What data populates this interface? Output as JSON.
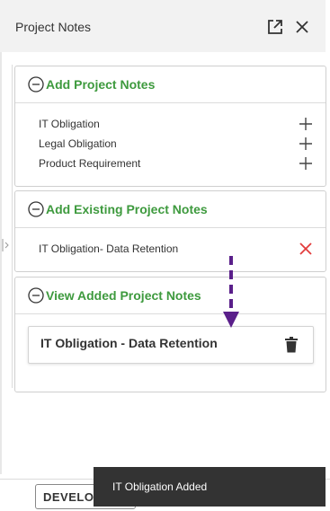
{
  "header": {
    "title": "Project Notes",
    "popout_icon": "external-link-icon",
    "close_icon": "close-icon"
  },
  "add_notes": {
    "title": "Add Project Notes",
    "items": [
      {
        "label": "IT Obligation",
        "action_icon": "plus-icon"
      },
      {
        "label": "Legal Obligation",
        "action_icon": "plus-icon"
      },
      {
        "label": "Product Requirement",
        "action_icon": "plus-icon"
      }
    ]
  },
  "existing_notes": {
    "title": "Add Existing Project Notes",
    "items": [
      {
        "label": "IT Obligation- Data Retention",
        "action_icon": "remove-x-icon"
      }
    ]
  },
  "added_notes": {
    "title": "View Added Project Notes",
    "cards": [
      {
        "title": "IT Obligation - Data Retention",
        "action_icon": "trash-icon"
      }
    ]
  },
  "footer": {
    "button_label": "DEVELOPMENT"
  },
  "toast": {
    "message": "IT Obligation Added"
  },
  "colors": {
    "section_title": "#3e9a3e",
    "remove": "#e23c3c",
    "arrow": "#5a1f8a",
    "toast_bg": "#333333"
  }
}
